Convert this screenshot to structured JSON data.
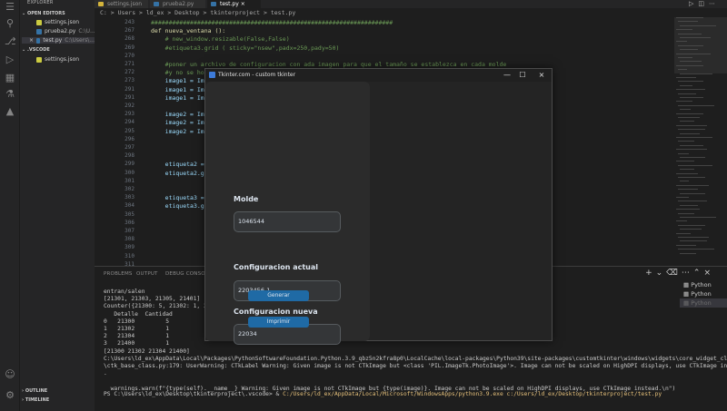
{
  "sidebar": {
    "explorer_header": "EXPLORER",
    "open_editors_label": "OPEN EDITORS",
    "open_editors": [
      {
        "name": "settings.json"
      },
      {
        "name": "prueba2.py",
        "path": "C:\\U..."
      },
      {
        "name": "test.py",
        "path": "C:\\Users\\..."
      }
    ],
    "folder_label": ".VSCODE",
    "folder_files": [
      {
        "name": "settings.json"
      }
    ],
    "outline_label": "OUTLINE",
    "timeline_label": "TIMELINE"
  },
  "tabs": [
    {
      "label": "settings.json"
    },
    {
      "label": "prueba2.py"
    },
    {
      "label": "test.py",
      "active": true
    }
  ],
  "breadcrumb": "C: > Users > ld_ex > Desktop > tkinterproject > test.py",
  "code": {
    "lines": [
      {
        "n": "243",
        "text": "####################################################################"
      },
      {
        "n": "267",
        "text": "def nueva_ventana ():"
      },
      {
        "n": "268",
        "text": "    # new_window.resizable(False,False)"
      },
      {
        "n": "269",
        "text": "    #etiqueta3.grid ( sticky=\"nsew\",padx=250,pady=50)"
      },
      {
        "n": "270",
        "text": ""
      },
      {
        "n": "271",
        "text": "    #poner un archivo de configuracion con ada imagen para que el tamaño se establezca en cada molde"
      },
      {
        "n": "272",
        "text": "    #y no se hoga un"
      },
      {
        "n": "273",
        "text": "    image1 = Image.o"
      },
      {
        "n": "291",
        "text": "    image1 = Image.o"
      },
      {
        "n": "291",
        "text": "    image1 = ImageTk"
      },
      {
        "n": "292",
        "text": ""
      },
      {
        "n": "293",
        "text": "    image2 = Image.o"
      },
      {
        "n": "294",
        "text": "    image2 = Image.2"
      },
      {
        "n": "295",
        "text": "    image2 = ImageTk"
      },
      {
        "n": "296",
        "text": ""
      },
      {
        "n": "297",
        "text": ""
      },
      {
        "n": "298",
        "text": ""
      },
      {
        "n": "299",
        "text": "    etiqueta2 = cust"
      },
      {
        "n": "300",
        "text": "    etiqueta2.grid(r"
      },
      {
        "n": "301",
        "text": ""
      },
      {
        "n": "302",
        "text": ""
      },
      {
        "n": "303",
        "text": "    etiqueta3 = cust"
      },
      {
        "n": "304",
        "text": "    etiqueta3.grid(r"
      },
      {
        "n": "305",
        "text": ""
      },
      {
        "n": "306",
        "text": ""
      },
      {
        "n": "307",
        "text": ""
      },
      {
        "n": "308",
        "text": ""
      },
      {
        "n": "309",
        "text": ""
      },
      {
        "n": "310",
        "text": ""
      },
      {
        "n": "311",
        "text": ""
      }
    ]
  },
  "panel": {
    "tabs": [
      "PROBLEMS",
      "OUTPUT",
      "DEBUG CONSOLE"
    ],
    "terminal_lines": [
      "entran/salen",
      "[21301, 21303, 21305, 21401]",
      "Counter({21300: 5, 21302: 1, 21304",
      "   Detalle  Cantidad",
      "0   21300         5",
      "1   21302         1",
      "2   21304         1",
      "3   21400         1",
      "[21300 21302 21304 21400]",
      "C:\\Users\\ld_ex\\AppData\\Local\\Packages\\PythonSoftwareFoundation.Python.3.9_qbz5n2kfra8p0\\LocalCache\\local-packages\\Python39\\site-packages\\customtkinter\\windows\\widgets\\core_widget_classes",
      "\\ctk_base_class.py:179: UserWarning: CTkLabel Warning: Given image is not CTkImage but <class 'PIL.ImageTk.PhotoImage'>. Image can not be scaled on HighDPI displays, use CTkImage instead",
      ".",
      "",
      "  warnings.warn(f\"{type(self).__name__} Warning: Given image is not CTkImage but {type(image)}. Image can not be scaled on HighDPI displays, use CTkImage instead.\\n\")"
    ],
    "prompt": "PS C:\\Users\\ld_ex\\Desktop\\tkinterproject\\.vscode> & ",
    "command": "C:/Users/ld_ex/AppData/Local/Microsoft/WindowsApps/python3.9.exe c:/Users/ld_ex/Desktop/tkinterproject/test.py",
    "terminals": [
      "Python",
      "Python",
      "Python"
    ]
  },
  "tk_window": {
    "title": "Tkinter.com - custom tkinter",
    "molde_label": "Molde",
    "molde_value": "1046544",
    "config_actual_label": "Configuracion actual",
    "config_actual_value": "2203456-1",
    "config_nueva_label": "Configuracion nueva",
    "config_nueva_value": "22034",
    "generar_label": "Generar",
    "imprimir_label": "Imprimir",
    "accent": "#1f6aa5"
  },
  "icons": [
    "files-icon",
    "search-icon",
    "source-control-icon",
    "run-debug-icon",
    "extensions-icon",
    "testing-icon",
    "account-icon",
    "settings-gear-icon"
  ]
}
